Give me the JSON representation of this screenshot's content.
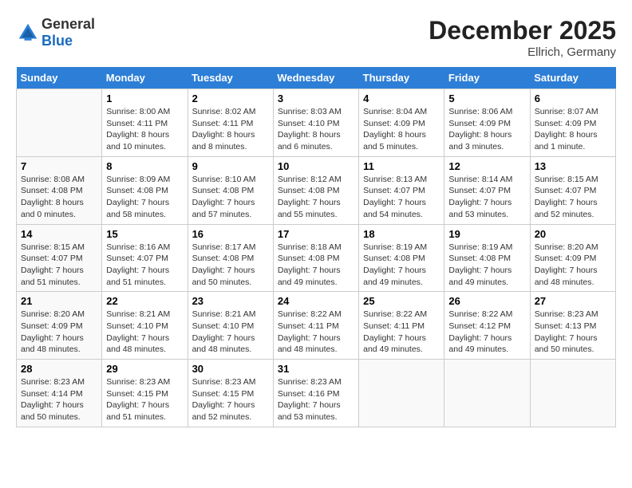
{
  "header": {
    "logo_general": "General",
    "logo_blue": "Blue",
    "month": "December 2025",
    "location": "Ellrich, Germany"
  },
  "days_of_week": [
    "Sunday",
    "Monday",
    "Tuesday",
    "Wednesday",
    "Thursday",
    "Friday",
    "Saturday"
  ],
  "weeks": [
    [
      {
        "day": "",
        "info": ""
      },
      {
        "day": "1",
        "info": "Sunrise: 8:00 AM\nSunset: 4:11 PM\nDaylight: 8 hours\nand 10 minutes."
      },
      {
        "day": "2",
        "info": "Sunrise: 8:02 AM\nSunset: 4:11 PM\nDaylight: 8 hours\nand 8 minutes."
      },
      {
        "day": "3",
        "info": "Sunrise: 8:03 AM\nSunset: 4:10 PM\nDaylight: 8 hours\nand 6 minutes."
      },
      {
        "day": "4",
        "info": "Sunrise: 8:04 AM\nSunset: 4:09 PM\nDaylight: 8 hours\nand 5 minutes."
      },
      {
        "day": "5",
        "info": "Sunrise: 8:06 AM\nSunset: 4:09 PM\nDaylight: 8 hours\nand 3 minutes."
      },
      {
        "day": "6",
        "info": "Sunrise: 8:07 AM\nSunset: 4:09 PM\nDaylight: 8 hours\nand 1 minute."
      }
    ],
    [
      {
        "day": "7",
        "info": "Sunrise: 8:08 AM\nSunset: 4:08 PM\nDaylight: 8 hours\nand 0 minutes."
      },
      {
        "day": "8",
        "info": "Sunrise: 8:09 AM\nSunset: 4:08 PM\nDaylight: 7 hours\nand 58 minutes."
      },
      {
        "day": "9",
        "info": "Sunrise: 8:10 AM\nSunset: 4:08 PM\nDaylight: 7 hours\nand 57 minutes."
      },
      {
        "day": "10",
        "info": "Sunrise: 8:12 AM\nSunset: 4:08 PM\nDaylight: 7 hours\nand 55 minutes."
      },
      {
        "day": "11",
        "info": "Sunrise: 8:13 AM\nSunset: 4:07 PM\nDaylight: 7 hours\nand 54 minutes."
      },
      {
        "day": "12",
        "info": "Sunrise: 8:14 AM\nSunset: 4:07 PM\nDaylight: 7 hours\nand 53 minutes."
      },
      {
        "day": "13",
        "info": "Sunrise: 8:15 AM\nSunset: 4:07 PM\nDaylight: 7 hours\nand 52 minutes."
      }
    ],
    [
      {
        "day": "14",
        "info": "Sunrise: 8:15 AM\nSunset: 4:07 PM\nDaylight: 7 hours\nand 51 minutes."
      },
      {
        "day": "15",
        "info": "Sunrise: 8:16 AM\nSunset: 4:07 PM\nDaylight: 7 hours\nand 51 minutes."
      },
      {
        "day": "16",
        "info": "Sunrise: 8:17 AM\nSunset: 4:08 PM\nDaylight: 7 hours\nand 50 minutes."
      },
      {
        "day": "17",
        "info": "Sunrise: 8:18 AM\nSunset: 4:08 PM\nDaylight: 7 hours\nand 49 minutes."
      },
      {
        "day": "18",
        "info": "Sunrise: 8:19 AM\nSunset: 4:08 PM\nDaylight: 7 hours\nand 49 minutes."
      },
      {
        "day": "19",
        "info": "Sunrise: 8:19 AM\nSunset: 4:08 PM\nDaylight: 7 hours\nand 49 minutes."
      },
      {
        "day": "20",
        "info": "Sunrise: 8:20 AM\nSunset: 4:09 PM\nDaylight: 7 hours\nand 48 minutes."
      }
    ],
    [
      {
        "day": "21",
        "info": "Sunrise: 8:20 AM\nSunset: 4:09 PM\nDaylight: 7 hours\nand 48 minutes."
      },
      {
        "day": "22",
        "info": "Sunrise: 8:21 AM\nSunset: 4:10 PM\nDaylight: 7 hours\nand 48 minutes."
      },
      {
        "day": "23",
        "info": "Sunrise: 8:21 AM\nSunset: 4:10 PM\nDaylight: 7 hours\nand 48 minutes."
      },
      {
        "day": "24",
        "info": "Sunrise: 8:22 AM\nSunset: 4:11 PM\nDaylight: 7 hours\nand 48 minutes."
      },
      {
        "day": "25",
        "info": "Sunrise: 8:22 AM\nSunset: 4:11 PM\nDaylight: 7 hours\nand 49 minutes."
      },
      {
        "day": "26",
        "info": "Sunrise: 8:22 AM\nSunset: 4:12 PM\nDaylight: 7 hours\nand 49 minutes."
      },
      {
        "day": "27",
        "info": "Sunrise: 8:23 AM\nSunset: 4:13 PM\nDaylight: 7 hours\nand 50 minutes."
      }
    ],
    [
      {
        "day": "28",
        "info": "Sunrise: 8:23 AM\nSunset: 4:14 PM\nDaylight: 7 hours\nand 50 minutes."
      },
      {
        "day": "29",
        "info": "Sunrise: 8:23 AM\nSunset: 4:15 PM\nDaylight: 7 hours\nand 51 minutes."
      },
      {
        "day": "30",
        "info": "Sunrise: 8:23 AM\nSunset: 4:15 PM\nDaylight: 7 hours\nand 52 minutes."
      },
      {
        "day": "31",
        "info": "Sunrise: 8:23 AM\nSunset: 4:16 PM\nDaylight: 7 hours\nand 53 minutes."
      },
      {
        "day": "",
        "info": ""
      },
      {
        "day": "",
        "info": ""
      },
      {
        "day": "",
        "info": ""
      }
    ]
  ]
}
